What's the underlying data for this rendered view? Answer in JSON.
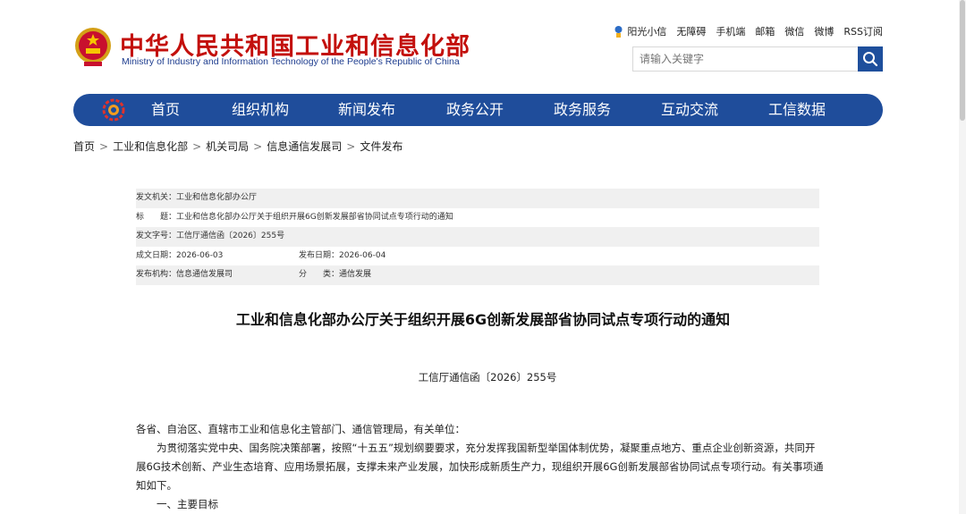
{
  "header": {
    "title_cn": "中华人民共和国工业和信息化部",
    "title_en": "Ministry of Industry and Information Technology of the People's Republic of China",
    "links": [
      "阳光小信",
      "无障碍",
      "手机端",
      "邮箱",
      "微信",
      "微博",
      "RSS订阅"
    ],
    "search_placeholder": "请输入关键字"
  },
  "nav": [
    "首页",
    "组织机构",
    "新闻发布",
    "政务公开",
    "政务服务",
    "互动交流",
    "工信数据"
  ],
  "breadcrumb": [
    "首页",
    "工业和信息化部",
    "机关司局",
    "信息通信发展司",
    "文件发布"
  ],
  "meta": {
    "issuer": "发文机关：工业和信息化部办公厅",
    "title": "标　　题：工业和信息化部办公厅关于组织开展6G创新发展部省协同试点专项行动的通知",
    "doc_no": "发文字号：工信厅通信函〔2026〕255号",
    "created": "成文日期：2026-06-03",
    "published": "发布日期：2026-06-04",
    "publisher": "发布机构：信息通信发展司",
    "category": "分　　类：通信发展"
  },
  "doc": {
    "title": "工业和信息化部办公厅关于组织开展6G创新发展部省协同试点专项行动的通知",
    "number": "工信厅通信函〔2026〕255号",
    "salutation": "各省、自治区、直辖市工业和信息化主管部门、通信管理局，有关单位：",
    "para1": "为贯彻落实党中央、国务院决策部署，按照“十五五”规划纲要要求，充分发挥我国新型举国体制优势，凝聚重点地方、重点企业创新资源，共同开展6G技术创新、产业生态培育、应用场景拓展，支撑未来产业发展，加快形成新质生产力，现组织开展6G创新发展部省协同试点专项行动。有关事项通知如下。",
    "heading1": "一、主要目标"
  },
  "colors": {
    "nav_bg": "#1f4d9b",
    "title_red": "#c3100c",
    "search_btn": "#1e4f9c"
  }
}
